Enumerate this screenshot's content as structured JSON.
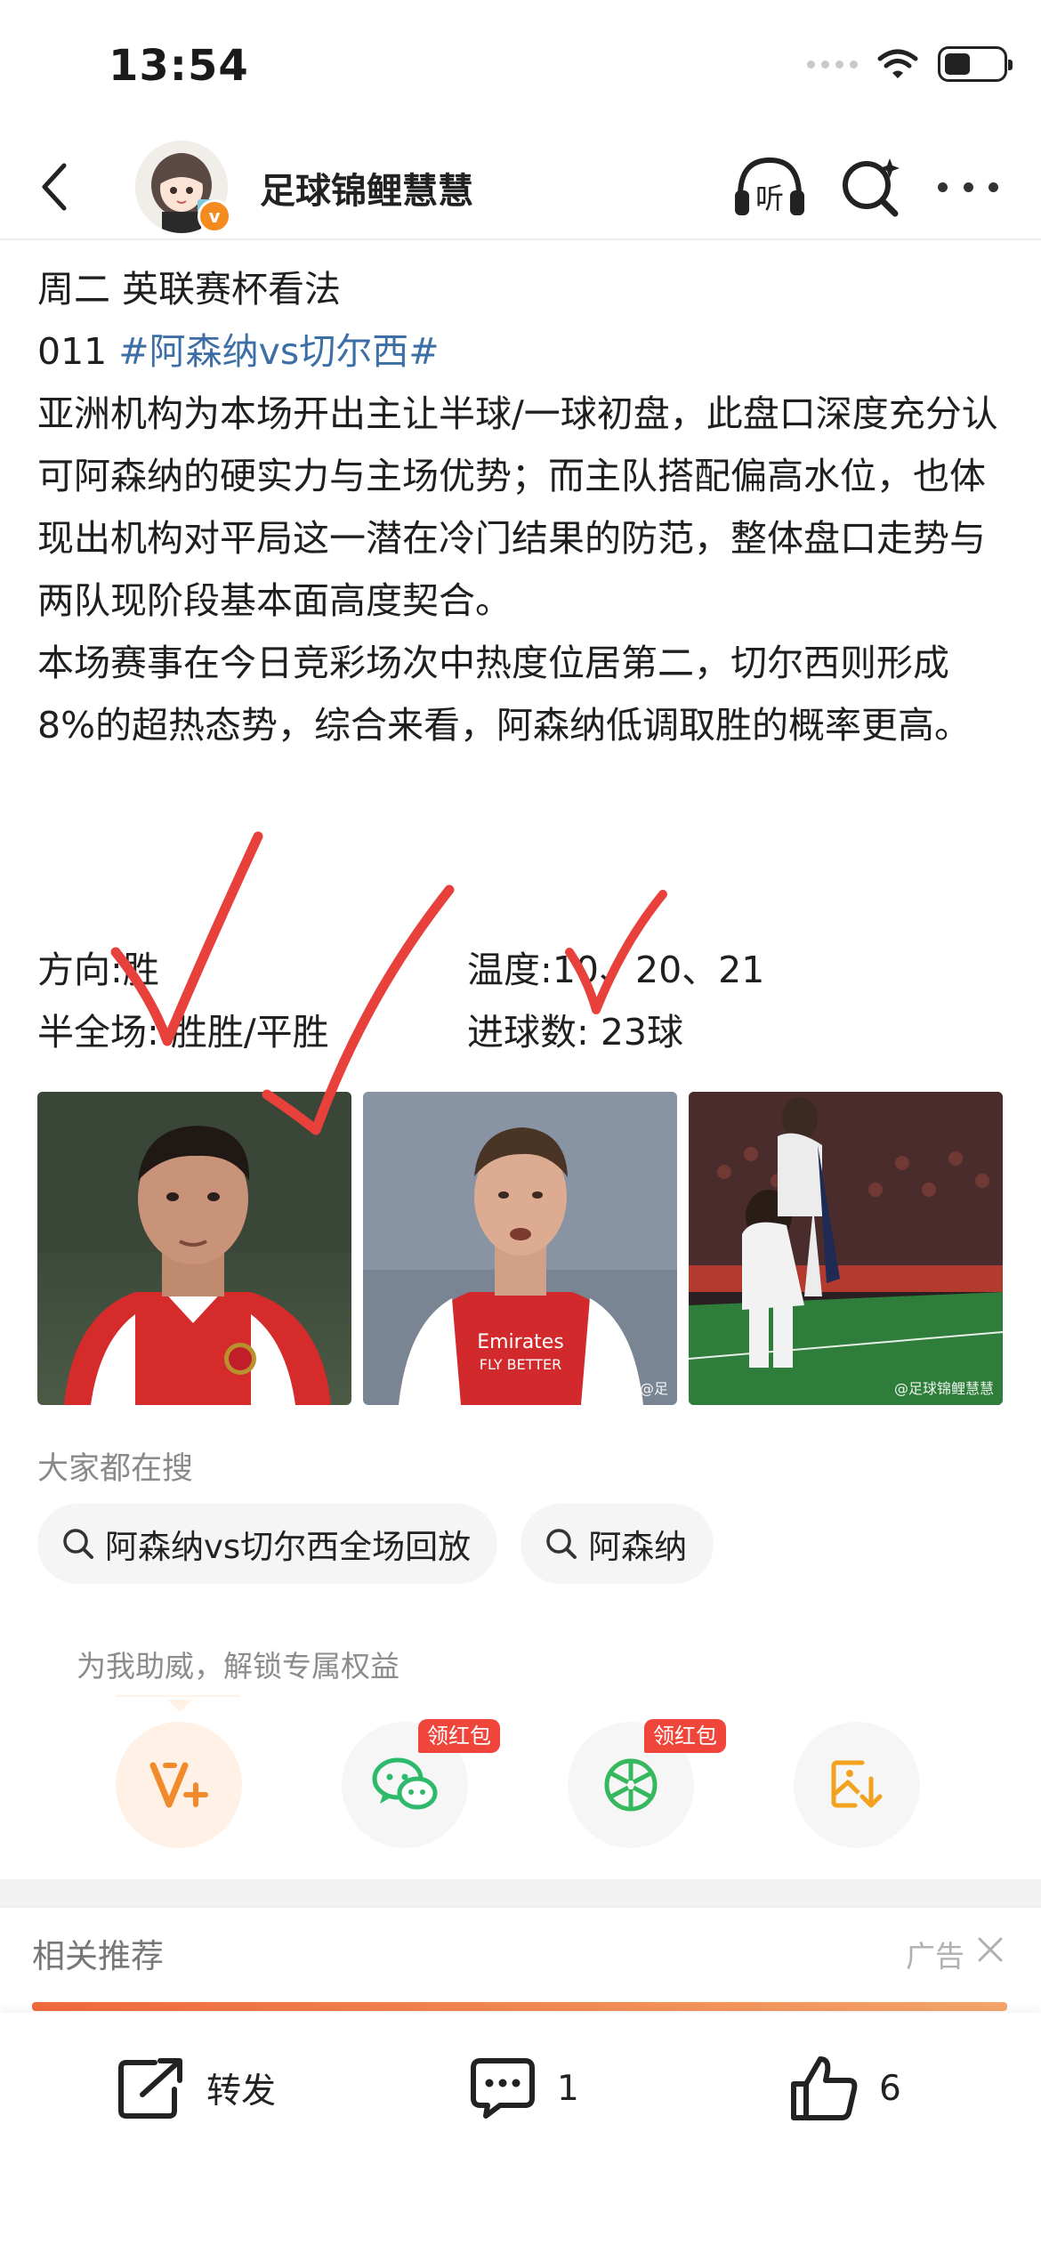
{
  "status_bar": {
    "time": "13:54"
  },
  "nav": {
    "author_name": "足球锦鲤慧慧",
    "verified_badge": "v",
    "listen_label": "听"
  },
  "post": {
    "lines": [
      "周二 英联赛杯看法",
      "011 ",
      "亚洲机构为本场开出主让半球/一球初盘，此盘口深度充分认可阿森纳的硬实力与主场优势；而主队搭配偏高水位，也体现出机构对平局这一潜在冷门结果的防范，整体盘口走势与两队现阶段基本面高度契合。",
      "本场赛事在今日竞彩场次中热度位居第二，切尔西则形成8%的超热态势，综合来看，阿森纳低调取胜的概率更高。"
    ],
    "topic": "#阿森纳vs切尔西#",
    "stats": {
      "direction": "方向:胜",
      "temperature": "温度:10、20、21",
      "half_full": "半全场: 胜胜/平胜",
      "goals": "进球数: 23球"
    }
  },
  "images": {
    "watermark_2": "@足",
    "watermark_3": "@足球锦鲤慧慧"
  },
  "trending": {
    "title": "大家都在搜",
    "chips": [
      "阿森纳vs切尔西全场回放",
      "阿森纳"
    ]
  },
  "support": {
    "hint": "为我助威，解锁专属权益",
    "redpack_label": "领红包"
  },
  "related": {
    "title": "相关推荐",
    "ad_label": "广告"
  },
  "toolbar": {
    "repost_label": "转发",
    "comment_count": "1",
    "like_count": "6"
  },
  "colors": {
    "topic_link": "#3d6fa7",
    "verified_orange": "#f38b1e",
    "redpack_red": "#f0453a",
    "check_mark_red": "#e8403a"
  }
}
